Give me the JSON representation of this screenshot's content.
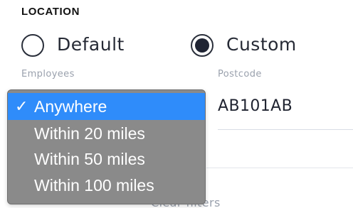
{
  "section": {
    "title": "LOCATION"
  },
  "radio": {
    "default_label": "Default",
    "custom_label": "Custom",
    "selected": "Custom"
  },
  "employees": {
    "label": "Employees",
    "selected": "Anywhere",
    "options": [
      "Anywhere",
      "Within 20 miles",
      "Within 50 miles",
      "Within 100 miles"
    ]
  },
  "postcode": {
    "label": "Postcode",
    "value": "AB101AB"
  },
  "footer": {
    "clear_label": "Clear filters"
  },
  "colors": {
    "selected_option": "#2f8cfa",
    "dropdown_bg": "#8a8a8a",
    "radio_dot": "#1f2433",
    "muted_text": "#9aa1ad"
  },
  "icons": {
    "checkmark": "checkmark-icon"
  }
}
